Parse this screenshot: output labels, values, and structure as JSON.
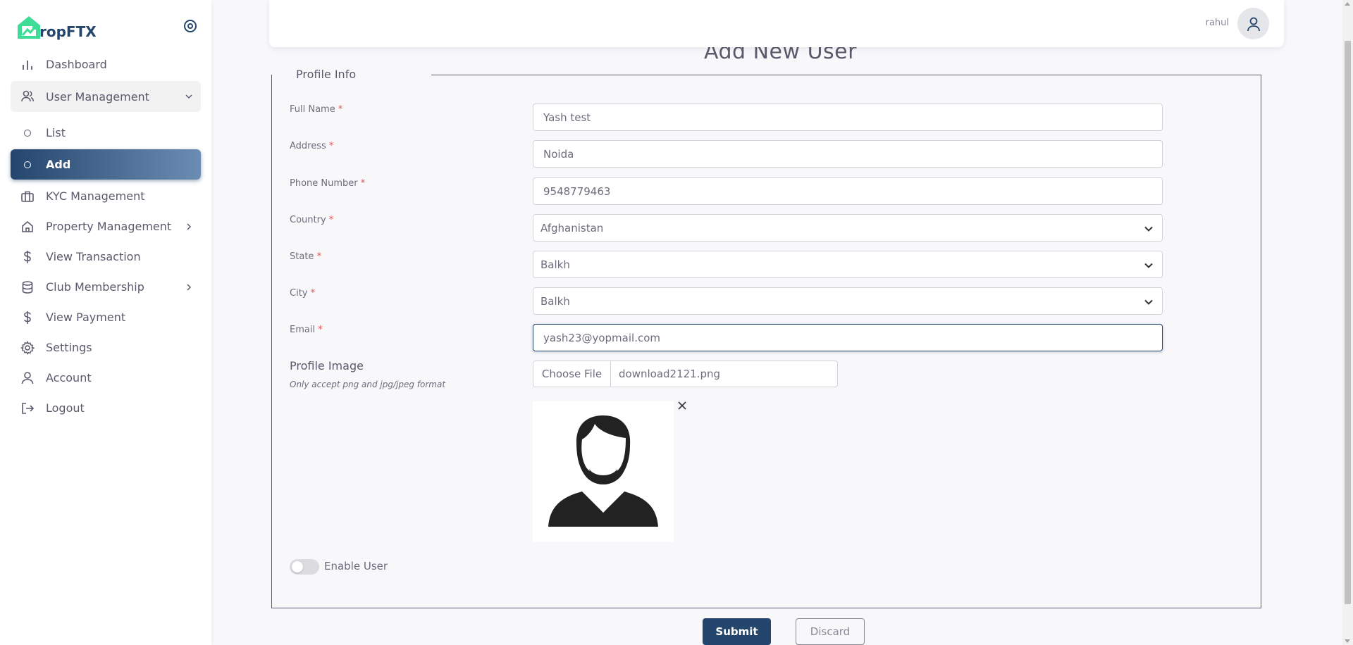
{
  "brand": {
    "name": "ropFTX",
    "accent": "#24466d",
    "logo_color": "#3ddc97"
  },
  "sidebar": {
    "items": [
      {
        "label": "Dashboard",
        "icon": "bar-chart-icon"
      },
      {
        "label": "User Management",
        "icon": "users-icon",
        "expanded": true
      },
      {
        "label": "List",
        "icon": "circle-icon"
      },
      {
        "label": "Add",
        "icon": "circle-icon",
        "active": true
      },
      {
        "label": "KYC Management",
        "icon": "briefcase-icon"
      },
      {
        "label": "Property Management",
        "icon": "home-icon"
      },
      {
        "label": "View Transaction",
        "icon": "dollar-icon"
      },
      {
        "label": "Club Membership",
        "icon": "database-icon"
      },
      {
        "label": "View Payment",
        "icon": "dollar-icon"
      },
      {
        "label": "Settings",
        "icon": "gear-icon"
      },
      {
        "label": "Account",
        "icon": "user-icon"
      },
      {
        "label": "Logout",
        "icon": "logout-icon"
      }
    ]
  },
  "header": {
    "username": "rahul"
  },
  "page": {
    "title": "Add New User",
    "legend": "Profile Info"
  },
  "form": {
    "full_name": {
      "label": "Full Name",
      "value": "Yash test"
    },
    "address": {
      "label": "Address",
      "value": "Noida"
    },
    "phone": {
      "label": "Phone Number",
      "value": "9548779463"
    },
    "country": {
      "label": "Country",
      "value": "Afghanistan"
    },
    "state": {
      "label": "State",
      "value": "Balkh"
    },
    "city": {
      "label": "City",
      "value": "Balkh"
    },
    "email": {
      "label": "Email",
      "value": "yash23@yopmail.com"
    },
    "required_mark": "*",
    "profile_image": {
      "title": "Profile Image",
      "hint": "Only accept png and jpg/jpeg format",
      "button": "Choose File",
      "file_name": "download2121.png"
    },
    "enable_user": {
      "label": "Enable User",
      "on": false
    },
    "submit": "Submit",
    "discard": "Discard"
  }
}
